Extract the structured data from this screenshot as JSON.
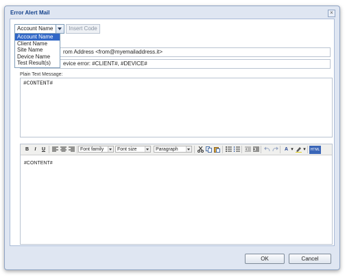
{
  "window": {
    "title": "Error Alert Mail",
    "close_glyph": "×"
  },
  "placeholder_combo": {
    "selected": "Account Name",
    "options": [
      "Account Name",
      "Client Name",
      "Site Name",
      "Device Name",
      "Test Result(s)"
    ]
  },
  "insert_button": "Insert Code",
  "from_field": {
    "value": "rom Address <from@myemailaddress.it>"
  },
  "subject_field": {
    "value": "evice error: #CLIENT#, #DEVICE#"
  },
  "plain_text": {
    "label": "Plain Text Message:",
    "value": "#CONTENT#"
  },
  "rich_editor": {
    "toolbar": {
      "bold": "B",
      "italic": "I",
      "underline": "U",
      "font_family": "Font family",
      "font_size": "Font size",
      "format": "Paragraph",
      "html_button": "HTML"
    },
    "content": "#CONTENT#"
  },
  "footer": {
    "ok": "OK",
    "cancel": "Cancel"
  },
  "colors": {
    "accent": "#3167c7",
    "title": "#15428b",
    "frame": "#dfe6f2"
  }
}
